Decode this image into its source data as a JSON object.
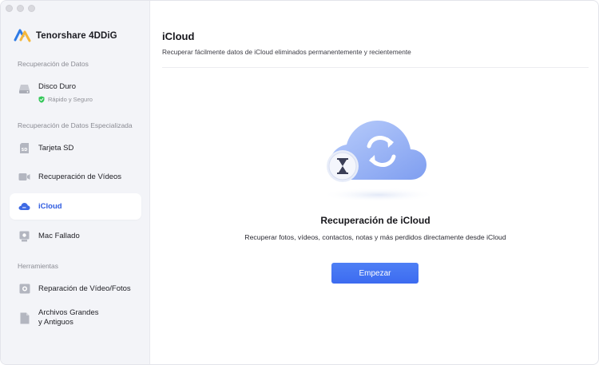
{
  "app": {
    "name": "Tenorshare 4DDiG"
  },
  "sidebar": {
    "sections": [
      {
        "label": "Recuperación de Datos"
      },
      {
        "label": "Recuperación de Datos Especializada"
      },
      {
        "label": "Herramientas"
      }
    ],
    "items": [
      {
        "label": "Disco Duro",
        "sublabel": "Rápido y Seguro",
        "icon": "hard-drive-icon"
      },
      {
        "label": "Tarjeta SD",
        "icon": "sd-card-icon"
      },
      {
        "label": "Recuperación de Vídeos",
        "icon": "video-camera-icon"
      },
      {
        "label": "iCloud",
        "icon": "cloud-icon",
        "active": true
      },
      {
        "label": "Mac Fallado",
        "icon": "mac-crashed-icon"
      },
      {
        "label": "Reparación de Vídeo/Fotos",
        "icon": "photo-repair-icon"
      },
      {
        "label": "Archivos Grandes",
        "label2": "y Antiguos",
        "icon": "large-files-icon"
      }
    ]
  },
  "main": {
    "title": "iCloud",
    "subtitle": "Recuperar fácilmente datos de iCloud eliminados permanentemente y recientemente",
    "hero_title": "Recuperación de iCloud",
    "hero_description": "Recuperar fotos, vídeos, contactos, notas y más perdidos directamente desde iCloud",
    "start_button": "Empezar"
  },
  "colors": {
    "accent": "#3c6bf0",
    "sidebar_bg": "#f3f4f8",
    "active_text": "#2f5be0",
    "safe_green": "#34c759"
  }
}
